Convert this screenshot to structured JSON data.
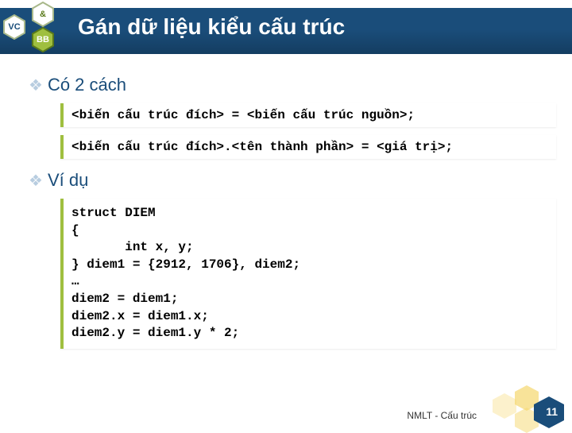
{
  "header": {
    "logo": {
      "vc": "VC",
      "amp": "&",
      "bb": "BB"
    },
    "title": "Gán dữ liệu kiểu cấu trúc"
  },
  "sections": {
    "ways": {
      "heading": "Có 2 cách",
      "line1": "<biến cấu trúc đích> = <biến cấu trúc nguồn>;",
      "line2": "<biến cấu trúc đích>.<tên thành phần> = <giá trị>;"
    },
    "example": {
      "heading": "Ví dụ",
      "code": "struct DIEM\n{\n       int x, y;\n} diem1 = {2912, 1706}, diem2;\n…\ndiem2 = diem1;\ndiem2.x = diem1.x;\ndiem2.y = diem1.y * 2;"
    }
  },
  "footer": {
    "text": "NMLT - Cấu trúc",
    "page": "11"
  },
  "colors": {
    "brand_blue": "#1a4d7a",
    "olive": "#9fbf3f",
    "hex_yellow": "#f5d76e"
  }
}
